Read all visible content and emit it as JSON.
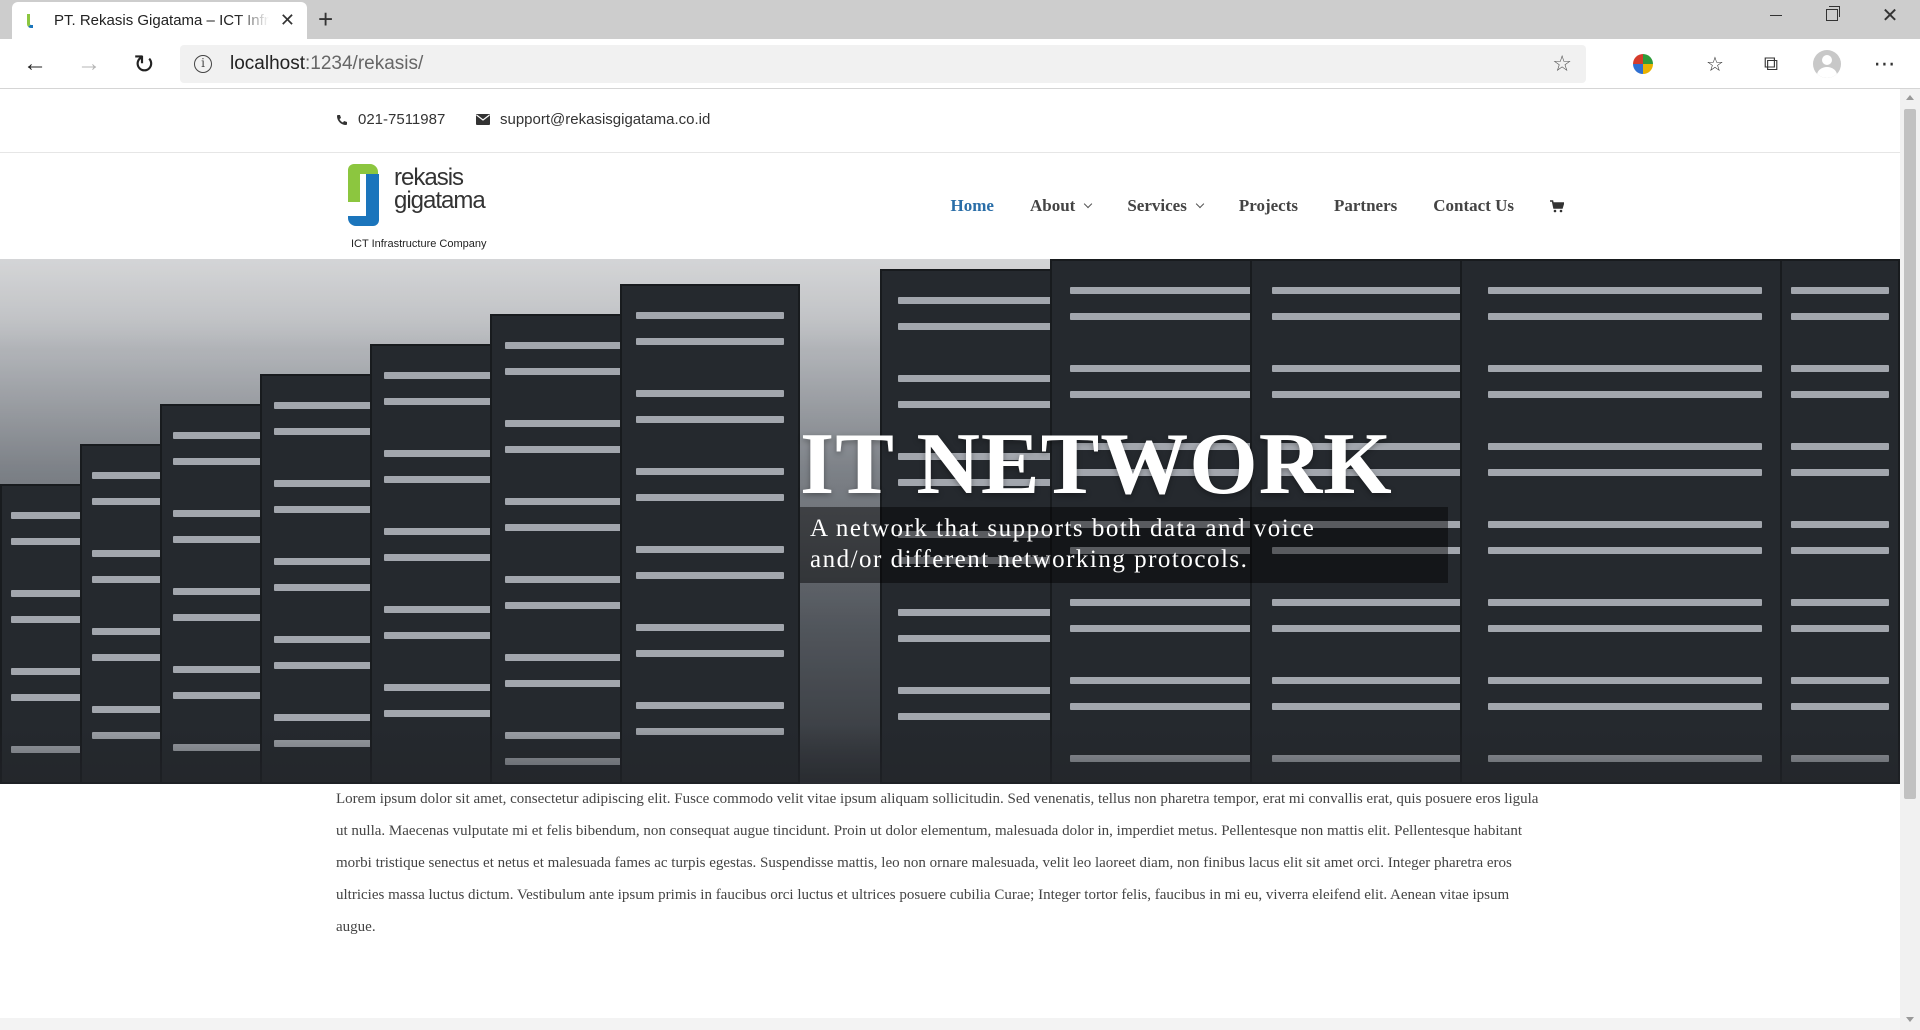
{
  "browser": {
    "tab_title": "PT. Rekasis Gigatama – ICT Infrastructure Company",
    "url_host": "localhost",
    "url_path": ":1234/rekasis/"
  },
  "topbar": {
    "phone": "021-7511987",
    "email": "support@rekasisgigatama.co.id"
  },
  "logo": {
    "line1": "rekasis",
    "line2": "gigatama",
    "tagline": "ICT Infrastructure Company"
  },
  "nav": {
    "items": [
      {
        "label": "Home",
        "active": true,
        "dropdown": false
      },
      {
        "label": "About",
        "active": false,
        "dropdown": true
      },
      {
        "label": "Services",
        "active": false,
        "dropdown": true
      },
      {
        "label": "Projects",
        "active": false,
        "dropdown": false
      },
      {
        "label": "Partners",
        "active": false,
        "dropdown": false
      },
      {
        "label": "Contact Us",
        "active": false,
        "dropdown": false
      }
    ],
    "cart_icon": "shopping-cart-icon"
  },
  "hero": {
    "title": "IT NETWORK",
    "subtitle_line1": "A network that supports both data and voice",
    "subtitle_line2": "and/or different networking protocols."
  },
  "content": {
    "paragraph": "Lorem ipsum dolor sit amet, consectetur adipiscing elit. Fusce commodo velit vitae ipsum aliquam sollicitudin. Sed venenatis, tellus non pharetra tempor, erat mi convallis erat, quis posuere eros ligula ut nulla. Maecenas vulputate mi et felis bibendum, non consequat augue tincidunt. Proin ut dolor elementum, malesuada dolor in, imperdiet metus. Pellentesque non mattis elit. Pellentesque habitant morbi tristique senectus et netus et malesuada fames ac turpis egestas. Suspendisse mattis, leo non ornare malesuada, velit leo laoreet diam, non finibus lacus elit sit amet orci. Integer pharetra eros ultricies massa luctus dictum. Vestibulum ante ipsum primis in faucibus orci luctus et ultrices posuere cubilia Curae; Integer tortor felis, faucibus in mi eu, viverra eleifend elit. Aenean vitae ipsum augue."
  },
  "colors": {
    "nav_active": "#2a6ea8",
    "logo_green": "#8cc63f",
    "logo_blue": "#1b75bc"
  }
}
